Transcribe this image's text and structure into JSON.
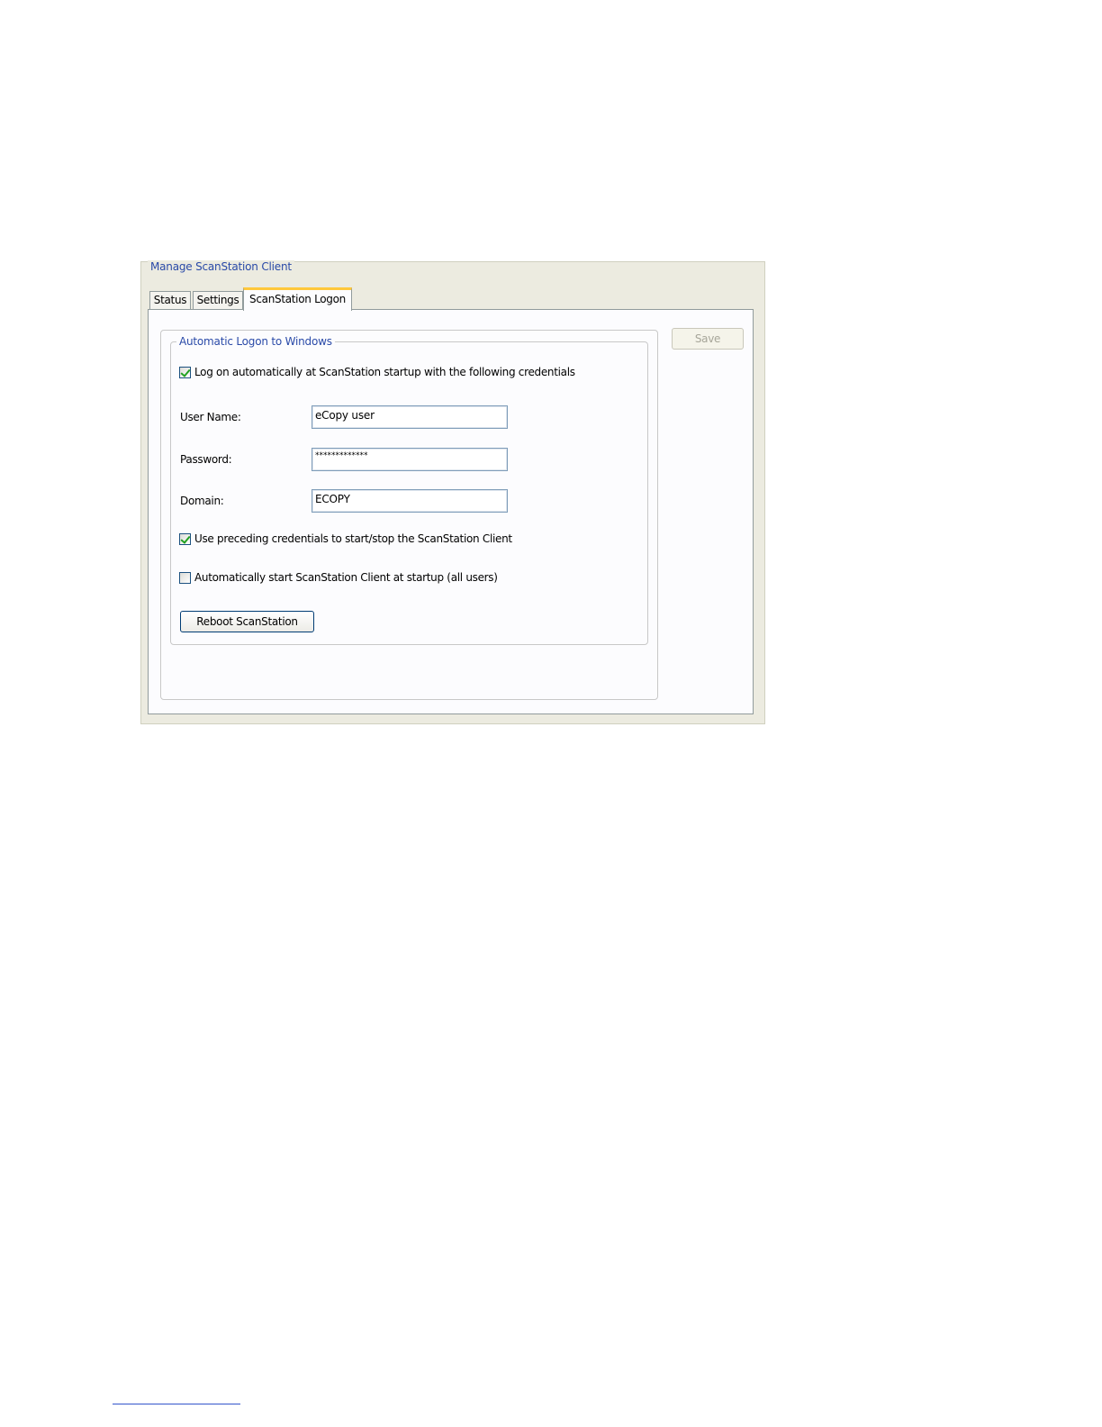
{
  "window": {
    "group_title": "Manage ScanStation Client"
  },
  "tabs": [
    {
      "label": "Status",
      "active": false
    },
    {
      "label": "Settings",
      "active": false
    },
    {
      "label": "ScanStation Logon",
      "active": true
    }
  ],
  "logon_group": {
    "title": "Automatic Logon to Windows",
    "auto_logon": {
      "label": "Log on automatically at ScanStation startup with the following credentials",
      "checked": true
    },
    "fields": {
      "user_name": {
        "label": "User Name:",
        "value": "eCopy user"
      },
      "password": {
        "label": "Password:",
        "value": "*************"
      },
      "domain": {
        "label": "Domain:",
        "value": "ECOPY"
      }
    },
    "use_credentials": {
      "label": "Use preceding credentials to start/stop the ScanStation Client",
      "checked": true
    },
    "auto_start": {
      "label": "Automatically start ScanStation Client at startup (all users)",
      "checked": false
    },
    "reboot_label": "Reboot ScanStation"
  },
  "toolbar": {
    "save_label": "Save",
    "save_enabled": false
  },
  "colors": {
    "accent_title": "#2a4aa8",
    "active_tab_highlight": "#ffc83c",
    "checkmark": "#21a121",
    "panel_background": "#ecebe0"
  }
}
